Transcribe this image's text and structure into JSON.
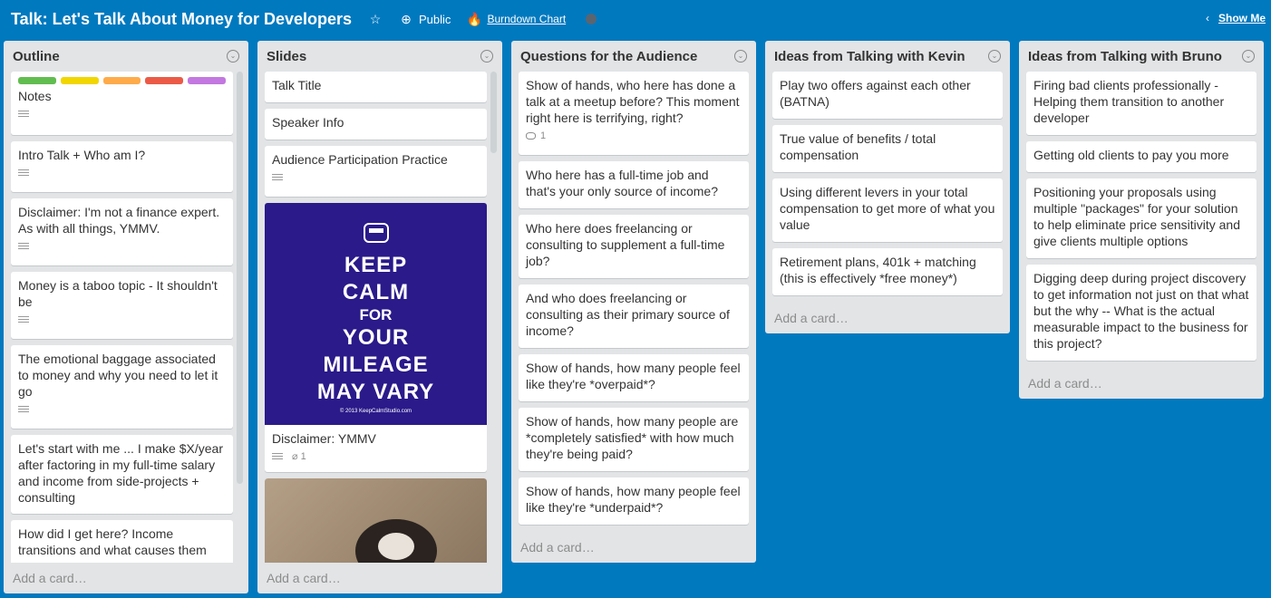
{
  "board": {
    "title": "Talk: Let's Talk About Money for Developers",
    "visibility": "Public",
    "burndown": "Burndown Chart",
    "show_menu": "Show Me"
  },
  "colors": {
    "background": "#0079bf",
    "list_bg": "#e2e4e6"
  },
  "labels": [
    "#61bd4f",
    "#f2d600",
    "#ffab4a",
    "#eb5a46",
    "#c377e0"
  ],
  "lists": [
    {
      "title": "Outline",
      "add": "Add a card…",
      "cards": [
        {
          "text": "Notes"
        },
        {
          "text": "Intro Talk + Who am I?"
        },
        {
          "text": "Disclaimer: I'm not a finance expert. As with all things, YMMV."
        },
        {
          "text": "Money is a taboo topic - It shouldn't be"
        },
        {
          "text": "The emotional baggage associated to money and why you need to let it go"
        },
        {
          "text": "Let's start with me ... I make $X/year after factoring in my full-time salary and income from side-projects + consulting"
        },
        {
          "text": "How did I get here? Income transitions and what causes them"
        }
      ]
    },
    {
      "title": "Slides",
      "add": "Add a card…",
      "cards": [
        {
          "text": "Talk Title"
        },
        {
          "text": "Speaker Info"
        },
        {
          "text": "Audience Participation Practice"
        },
        {
          "text": "Disclaimer: YMMV",
          "attachments": "1"
        }
      ],
      "cover": {
        "lines": [
          "KEEP",
          "CALM",
          "FOR",
          "YOUR",
          "MILEAGE",
          "MAY VARY"
        ],
        "footer": "© 2013 KeepCalmStudio.com"
      }
    },
    {
      "title": "Questions for the Audience",
      "add": "Add a card…",
      "cards": [
        {
          "text": "Show of hands, who here has done a talk at a meetup before? This moment right here is terrifying, right?",
          "comments": "1"
        },
        {
          "text": "Who here has a full-time job and that's your only source of income?"
        },
        {
          "text": "Who here does freelancing or consulting to supplement a full-time job?"
        },
        {
          "text": "And who does freelancing or consulting as their primary source of income?"
        },
        {
          "text": "Show of hands, how many people feel like they're *overpaid*?"
        },
        {
          "text": "Show of hands, how many people are *completely satisfied* with how much they're being paid?"
        },
        {
          "text": "Show of hands, how many people feel like they're *underpaid*?"
        }
      ]
    },
    {
      "title": "Ideas from Talking with Kevin",
      "add": "Add a card…",
      "cards": [
        {
          "text": "Play two offers against each other (BATNA)"
        },
        {
          "text": "True value of benefits / total compensation"
        },
        {
          "text": "Using different levers in your total compensation to get more of what you value"
        },
        {
          "text": "Retirement plans, 401k + matching (this is effectively *free money*)"
        }
      ]
    },
    {
      "title": "Ideas from Talking with Bruno",
      "add": "Add a card…",
      "cards": [
        {
          "text": "Firing bad clients professionally - Helping them transition to another developer"
        },
        {
          "text": "Getting old clients to pay you more"
        },
        {
          "text": "Positioning your proposals using multiple \"packages\" for your solution to help eliminate price sensitivity and give clients multiple options"
        },
        {
          "text": "Digging deep during project discovery to get information not just on that what but the why -- What is the actual measurable impact to the business for this project?"
        }
      ]
    }
  ]
}
